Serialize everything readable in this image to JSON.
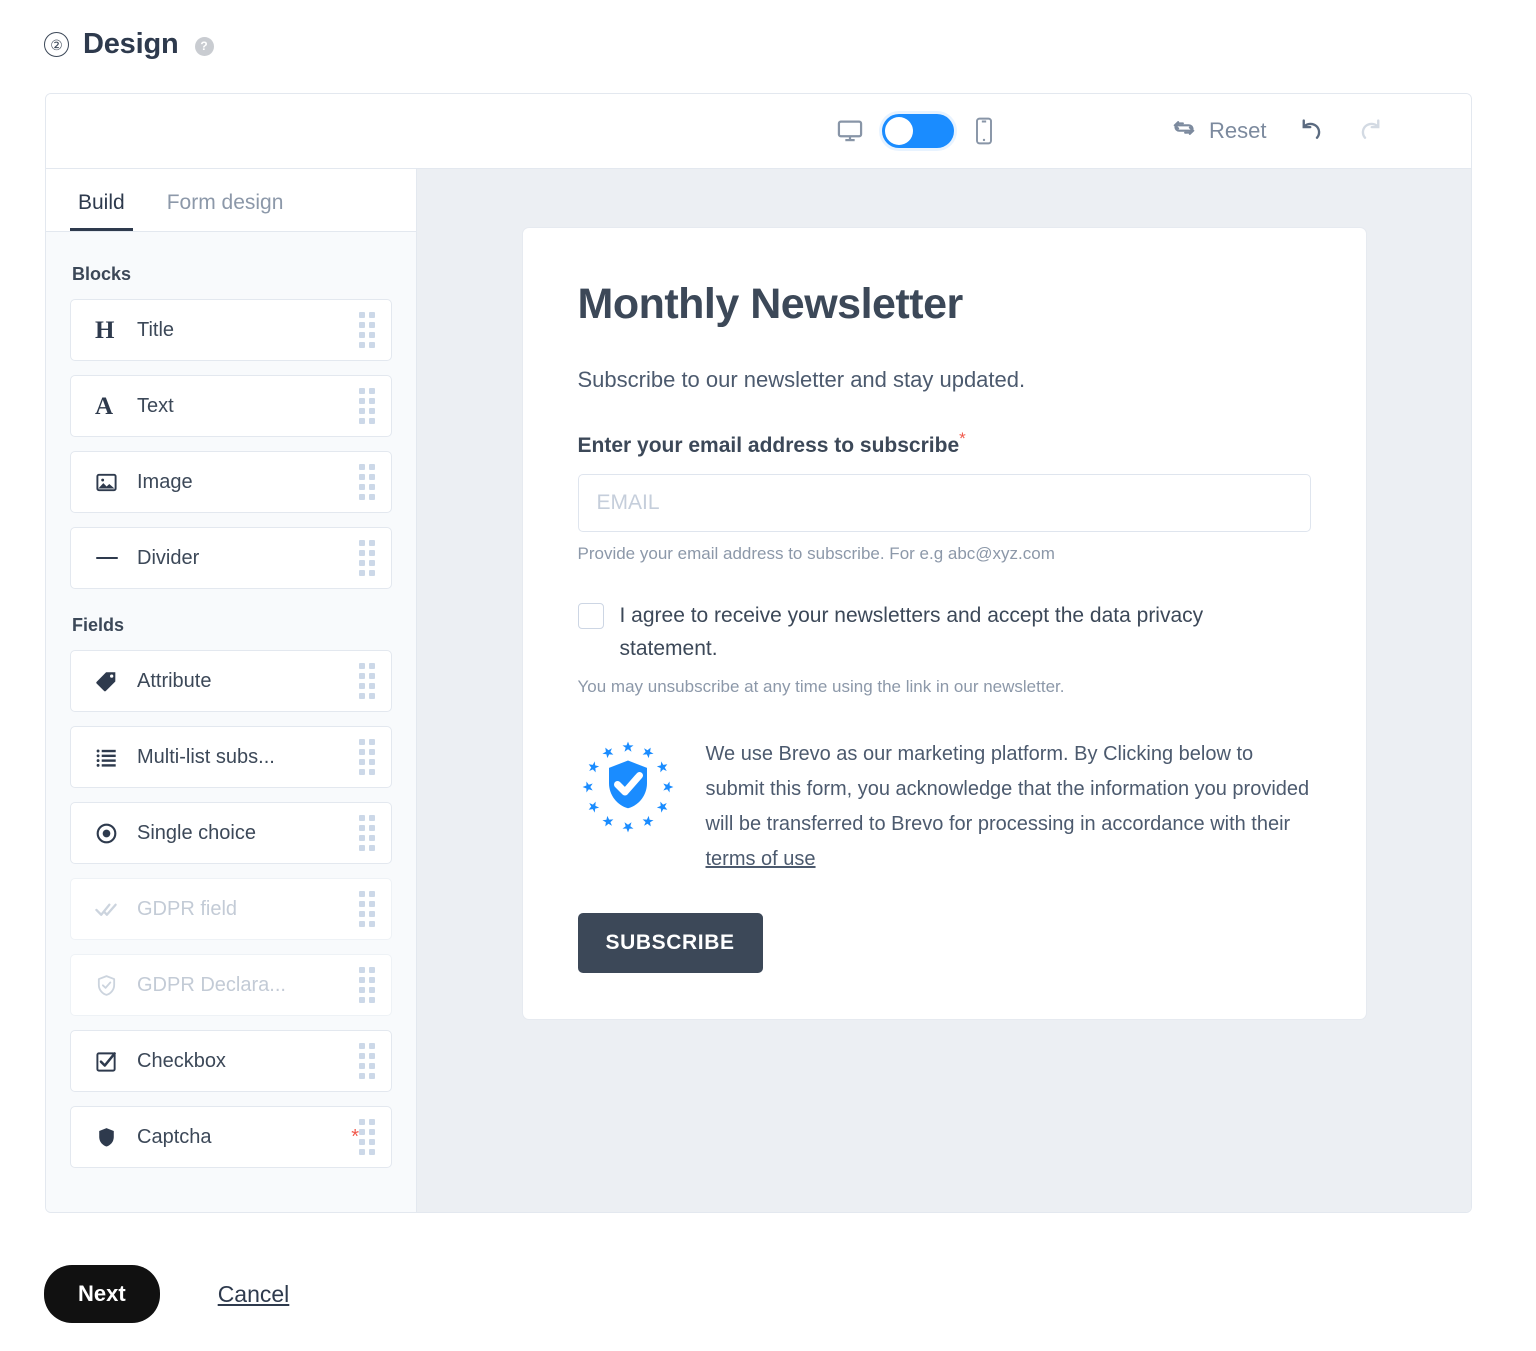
{
  "header": {
    "step_number": "②",
    "title": "Design",
    "help_icon": "question-mark-icon"
  },
  "toolbar": {
    "desktop_icon": "desktop-icon",
    "mobile_icon": "mobile-icon",
    "toggle_state": "on",
    "toggle_color": "#1a8cff",
    "reset_label": "Reset",
    "reset_icon": "refresh-icon",
    "undo_icon": "undo-icon",
    "redo_icon": "redo-icon",
    "redo_disabled": true
  },
  "sidebar": {
    "tabs": [
      {
        "label": "Build",
        "active": true
      },
      {
        "label": "Form design",
        "active": false
      }
    ],
    "sections": [
      {
        "label": "Blocks",
        "items": [
          {
            "label": "Title",
            "icon": "heading-icon",
            "glyph": "H",
            "disabled": false,
            "required": false
          },
          {
            "label": "Text",
            "icon": "text-icon",
            "glyph": "A",
            "disabled": false,
            "required": false
          },
          {
            "label": "Image",
            "icon": "image-icon",
            "disabled": false,
            "required": false
          },
          {
            "label": "Divider",
            "icon": "divider-icon",
            "disabled": false,
            "required": false
          }
        ]
      },
      {
        "label": "Fields",
        "items": [
          {
            "label": "Attribute",
            "icon": "tag-icon",
            "disabled": false,
            "required": false
          },
          {
            "label": "Multi-list subs...",
            "icon": "list-icon",
            "disabled": false,
            "required": false
          },
          {
            "label": "Single choice",
            "icon": "radio-icon",
            "disabled": false,
            "required": false
          },
          {
            "label": "GDPR field",
            "icon": "double-check-icon",
            "disabled": true,
            "required": false
          },
          {
            "label": "GDPR Declara...",
            "icon": "shield-check-icon",
            "disabled": true,
            "required": false
          },
          {
            "label": "Checkbox",
            "icon": "checkbox-icon",
            "disabled": false,
            "required": false
          },
          {
            "label": "Captcha",
            "icon": "shield-icon",
            "disabled": false,
            "required": true,
            "required_mark": "*"
          }
        ]
      }
    ]
  },
  "form": {
    "title": "Monthly Newsletter",
    "subtitle": "Subscribe to our newsletter and stay updated.",
    "email_label": "Enter your email address to subscribe",
    "email_required_mark": "*",
    "email_placeholder": "EMAIL",
    "email_value": "",
    "email_help": "Provide your email address to subscribe. For e.g abc@xyz.com",
    "consent_text": "I agree to receive your newsletters and accept the data privacy statement.",
    "consent_checked": false,
    "unsubscribe_note": "You may unsubscribe at any time using the link in our newsletter.",
    "gdpr_badge_icon": "eu-shield-check-icon",
    "gdpr_text_before_link": "We use Brevo as our marketing platform. By Clicking below to submit this form, you acknowledge that the information you provided will be transferred to Brevo for processing in accordance with their ",
    "gdpr_link_label": "terms of use",
    "submit_label": "SUBSCRIBE",
    "submit_color": "#3c4858"
  },
  "footer": {
    "next_label": "Next",
    "cancel_label": "Cancel"
  },
  "colors": {
    "accent_blue": "#1a8cff",
    "dark_slate": "#3c4858",
    "canvas_bg": "#eceff3",
    "sidebar_bg": "#f8fafc",
    "required_red": "#f0594c"
  }
}
